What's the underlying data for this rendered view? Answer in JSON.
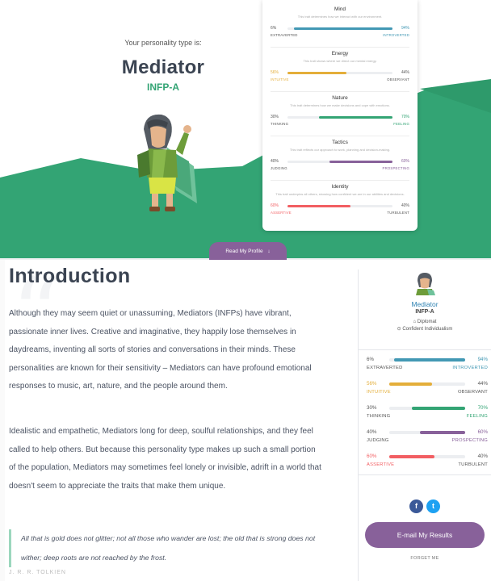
{
  "hero": {
    "type_label": "Your personality type is:",
    "type_name": "Mediator",
    "type_code": "INFP-A",
    "read_button": "Read My Profile",
    "read_arrow": "↓"
  },
  "colors": {
    "green": "#33a474",
    "purple": "#88619a",
    "blue": "#4298b4",
    "yellow": "#e4ae3a",
    "red": "#f25e62"
  },
  "traits": [
    {
      "title": "Mind",
      "desc": "This trait determines how we interact with our environment.",
      "left_pct": "6%",
      "right_pct": "94%",
      "left_label": "EXTRAVERTED",
      "right_label": "INTROVERTED",
      "value": 94,
      "side": "right",
      "highlight": "right",
      "color": "#4298b4"
    },
    {
      "title": "Energy",
      "desc": "This trait shows where we direct our mental energy.",
      "left_pct": "56%",
      "right_pct": "44%",
      "left_label": "INTUITIVE",
      "right_label": "OBSERVANT",
      "value": 56,
      "side": "left",
      "highlight": "left",
      "color": "#e4ae3a"
    },
    {
      "title": "Nature",
      "desc": "This trait determines how we make decisions and cope with emotions.",
      "left_pct": "30%",
      "right_pct": "70%",
      "left_label": "THINKING",
      "right_label": "FEELING",
      "value": 70,
      "side": "right",
      "highlight": "right",
      "color": "#33a474"
    },
    {
      "title": "Tactics",
      "desc": "This trait reflects our approach to work, planning and decision-making.",
      "left_pct": "40%",
      "right_pct": "60%",
      "left_label": "JUDGING",
      "right_label": "PROSPECTING",
      "value": 60,
      "side": "right",
      "highlight": "right",
      "color": "#88619a"
    },
    {
      "title": "Identity",
      "desc": "This trait underpins all others, showing how confident we are in our abilities and decisions.",
      "left_pct": "60%",
      "right_pct": "40%",
      "left_label": "ASSERTIVE",
      "right_label": "TURBULENT",
      "value": 60,
      "side": "left",
      "highlight": "left",
      "color": "#f25e62"
    }
  ],
  "intro": {
    "title": "Introduction",
    "para1": "Although they may seem quiet or unassuming, Mediators (INFPs) have vibrant, passionate inner lives. Creative and imaginative, they happily lose themselves in daydreams, inventing all sorts of stories and conversations in their minds. These personalities are known for their sensitivity – Mediators can have profound emotional responses to music, art, nature, and the people around them.",
    "para2": "Idealistic and empathetic, Mediators long for deep, soulful relationships, and they feel called to help others. But because this personality type makes up such a small portion of the population, Mediators may sometimes feel lonely or invisible, adrift in a world that doesn't seem to appreciate the traits that make them unique.",
    "quote": "All that is gold does not glitter; not all those who wander are lost; the old that is strong does not wither; deep roots are not reached by the frost.",
    "quote_author": "J. R. R. TOLKIEN"
  },
  "sidebar": {
    "type_name": "Mediator",
    "type_code": "INFP-A",
    "role": "Diplomat",
    "strategy": "Confident Individualism",
    "facebook": "f",
    "twitter": "t",
    "email_button": "E-mail My Results",
    "forget": "FORGET ME"
  }
}
